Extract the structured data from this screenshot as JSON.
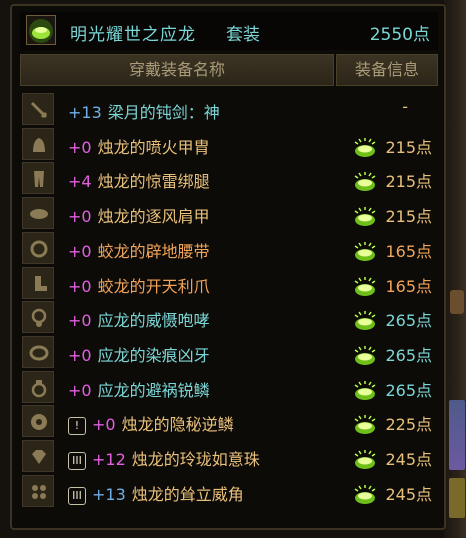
{
  "header": {
    "title": "明光耀世之应龙",
    "suffix": "套装",
    "total": "2550点",
    "icon": "green-orb-icon"
  },
  "columns": {
    "name": "穿戴装备名称",
    "info": "装备信息"
  },
  "colors": {
    "cyan": "#7bd6d6",
    "orange": "#f0a35a",
    "gold": "#e8c07a",
    "magenta": "#e060e0",
    "blue_level": "#6fb0e8"
  },
  "rows": [
    {
      "slot_icon": "weapon-icon",
      "badge": "",
      "level": "+13",
      "name": "梁月的钝剑：神",
      "points": "-",
      "orb": false
    },
    {
      "slot_icon": "helmet-armor-icon",
      "badge": "",
      "level": "+0",
      "name": "烛龙的喷火甲胄",
      "points": "215点",
      "orb": true
    },
    {
      "slot_icon": "leggings-icon",
      "badge": "",
      "level": "+4",
      "name": "烛龙的惊雷绑腿",
      "points": "215点",
      "orb": true
    },
    {
      "slot_icon": "shoulder-icon",
      "badge": "",
      "level": "+0",
      "name": "烛龙的逐风肩甲",
      "points": "215点",
      "orb": true
    },
    {
      "slot_icon": "belt-icon",
      "badge": "",
      "level": "+0",
      "name": "蛟龙的辟地腰带",
      "points": "165点",
      "orb": true
    },
    {
      "slot_icon": "boots-icon",
      "badge": "",
      "level": "+0",
      "name": "蛟龙的开天利爪",
      "points": "165点",
      "orb": true
    },
    {
      "slot_icon": "necklace-icon",
      "badge": "",
      "level": "+0",
      "name": "应龙的威慑咆哮",
      "points": "265点",
      "orb": true
    },
    {
      "slot_icon": "bracelet-icon",
      "badge": "",
      "level": "+0",
      "name": "应龙的染痕凶牙",
      "points": "265点",
      "orb": true
    },
    {
      "slot_icon": "ring-icon",
      "badge": "",
      "level": "+0",
      "name": "应龙的避祸锐鳞",
      "points": "265点",
      "orb": true
    },
    {
      "slot_icon": "subequip-icon",
      "badge": "!",
      "level": "+0",
      "name": "烛龙的隐秘逆鳞",
      "points": "225点",
      "orb": true
    },
    {
      "slot_icon": "gem-icon",
      "badge": "III",
      "level": "+12",
      "name": "烛龙的玲珑如意珠",
      "points": "245点",
      "orb": true
    },
    {
      "slot_icon": "earring-icon",
      "badge": "III",
      "level": "+13",
      "name": "烛龙的耸立威角",
      "points": "245点",
      "orb": true
    }
  ]
}
